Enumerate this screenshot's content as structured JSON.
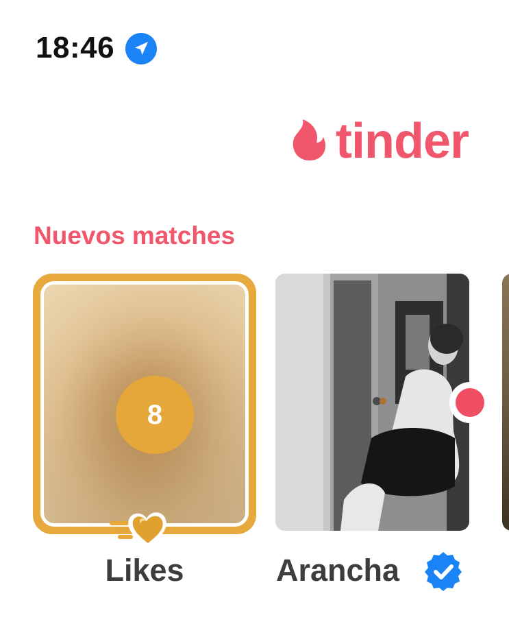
{
  "status_bar": {
    "time": "18:46",
    "location_icon": "location-arrow-icon"
  },
  "header": {
    "logo_icon": "tinder-flame-icon",
    "logo_text": "tinder"
  },
  "new_matches": {
    "title": "Nuevos matches",
    "likes_tile": {
      "count": "8",
      "label": "Likes",
      "badge_icon": "gold-heart-icon"
    },
    "matches": [
      {
        "name": "Arancha",
        "verified_icon": "verified-badge-icon",
        "new_indicator": true
      }
    ]
  },
  "colors": {
    "brand": "#f0566c",
    "gold": "#e8a93c",
    "verified_blue": "#1a83f5",
    "text": "#3d3d3d"
  }
}
